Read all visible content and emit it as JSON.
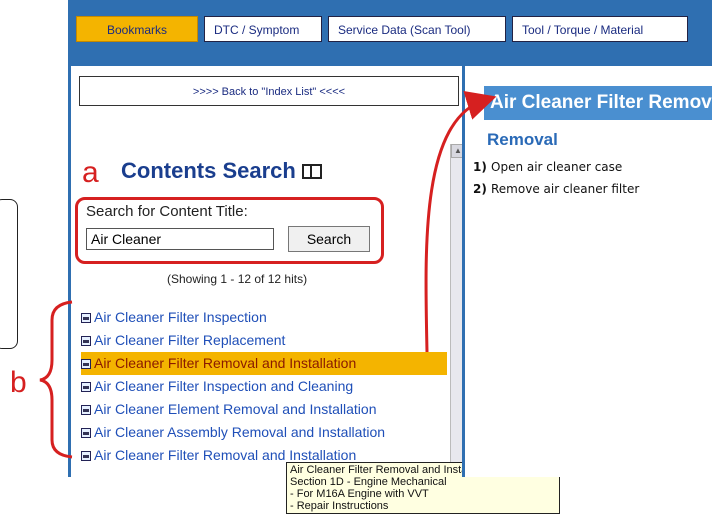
{
  "tabs": [
    {
      "label": "Bookmarks",
      "active": true
    },
    {
      "label": "DTC / Symptom",
      "active": false
    },
    {
      "label": "Service Data (Scan Tool)",
      "active": false
    },
    {
      "label": "Tool / Torque / Material",
      "active": false
    }
  ],
  "left_panel": {
    "back_link": ">>>> Back to \"Index List\" <<<<",
    "title": "Contents Search",
    "search": {
      "label": "Search for Content Title:",
      "value": "Air Cleaner",
      "button_label": "Search"
    },
    "hits_text": "(Showing 1 - 12 of 12 hits)",
    "results": [
      {
        "label": "Air Cleaner Filter Inspection"
      },
      {
        "label": "Air Cleaner Filter Replacement"
      },
      {
        "label": "Air Cleaner Filter Removal and Installation"
      },
      {
        "label": "Air Cleaner Filter Inspection and Cleaning"
      },
      {
        "label": "Air Cleaner Element Removal and Installation"
      },
      {
        "label": "Air Cleaner Assembly Removal and Installation"
      },
      {
        "label": "Air Cleaner Filter Removal and Installation"
      }
    ],
    "tooltip_lines": [
      "Air Cleaner Filter Removal and Installation",
      "Section 1D - Engine Mechanical",
      "- For M16A Engine with VVT",
      "- Repair Instructions"
    ]
  },
  "right_panel": {
    "header": "Air Cleaner Filter Removal and Installation",
    "section": "Removal",
    "steps": [
      {
        "num": "1)",
        "text": "Open air cleaner case"
      },
      {
        "num": "2)",
        "text": "Remove air cleaner filter"
      }
    ]
  },
  "annotations": {
    "a": "a",
    "b": "b"
  },
  "colors": {
    "tab_bar": "#2f6fb1",
    "active_tab": "#f4b400",
    "link": "#1f4fb8",
    "annotation": "#d62020",
    "header_bg": "#4a8fd0"
  }
}
